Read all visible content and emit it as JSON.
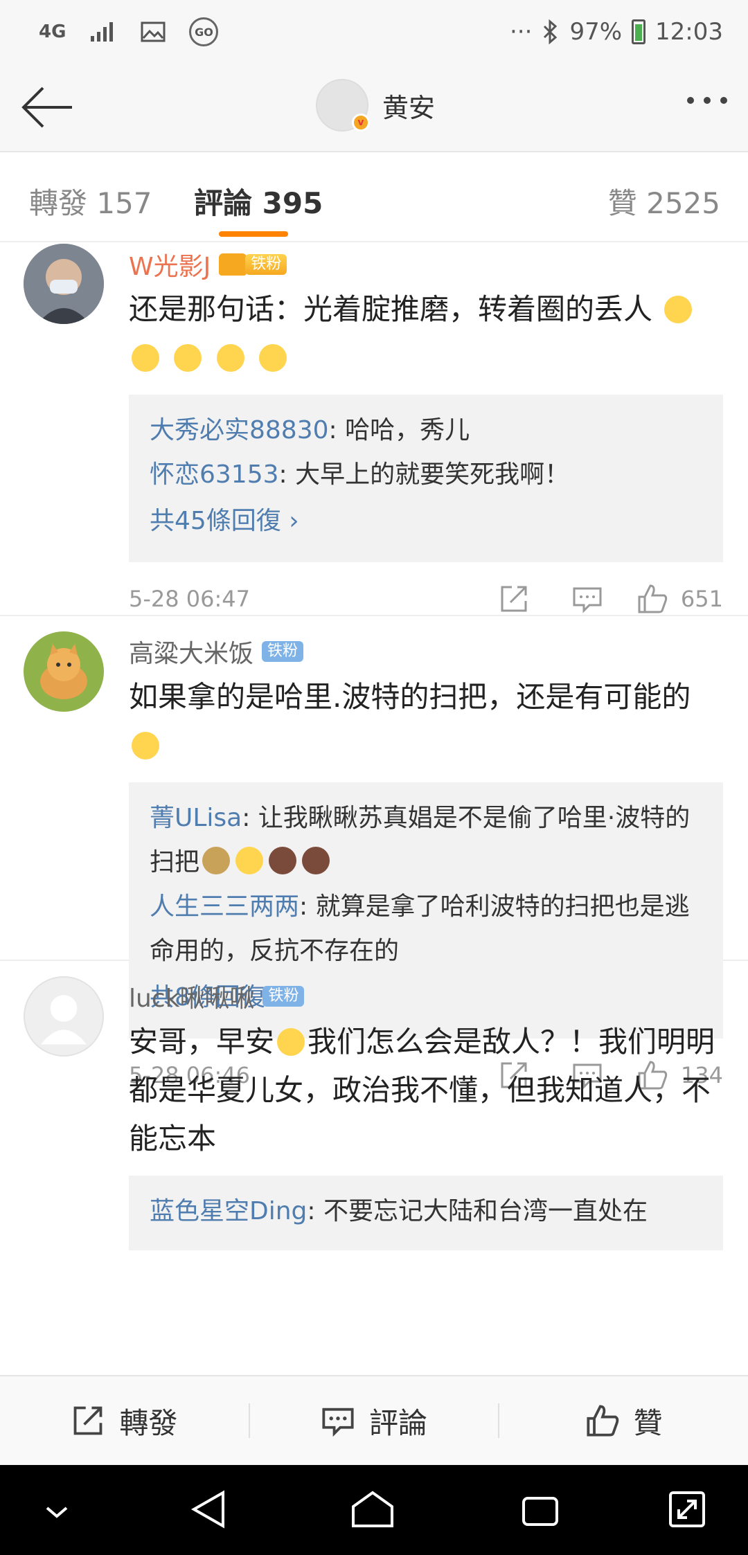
{
  "status_bar": {
    "network": "4G",
    "battery": "97%",
    "time": "12:03",
    "dots": "···"
  },
  "header": {
    "title": "黄安",
    "verified_badge": "v"
  },
  "tabs": [
    {
      "label": "轉發 157"
    },
    {
      "label": "評論 395"
    },
    {
      "label": "贊 2525"
    }
  ],
  "comments": [
    {
      "author": "W光影J",
      "badge": "铁粉",
      "text": "还是那句话：光着腚推磨，转着圈的丢人",
      "replies": [
        {
          "name": "大秀必实88830",
          "text": ": 哈哈，秀儿"
        },
        {
          "name": "怀恋63153",
          "text": ": 大早上的就要笑死我啊！"
        }
      ],
      "more": "共45條回復 ›",
      "time": "5-28 06:47",
      "likes": "651"
    },
    {
      "author": "高粱大米饭",
      "badge": "铁粉",
      "text": "如果拿的是哈里.波特的扫把，还是有可能的",
      "replies": [
        {
          "name": "菁ULisa",
          "text": ": 让我瞅瞅苏真娼是不是偷了哈里·波特的扫把"
        },
        {
          "name": "人生三三两两",
          "text": ": 就算是拿了哈利波特的扫把也是逃命用的，反抗不存在的"
        }
      ],
      "more": "共8條回復 ›",
      "time": "5-28 06:46",
      "likes": "134"
    },
    {
      "author": "luck啾啾啾",
      "badge": "铁粉",
      "text_a": "安哥，早安",
      "text_b": "我们怎么会是敌人？！我们明明都是华夏儿女，政治我不懂，但我知道人，不能忘本",
      "replies": [
        {
          "name": "蓝色星空Ding",
          "text": ": 不要忘记大陆和台湾一直处在"
        }
      ]
    }
  ],
  "bottom_bar": {
    "repost": "轉發",
    "comment": "評論",
    "like": "贊"
  }
}
